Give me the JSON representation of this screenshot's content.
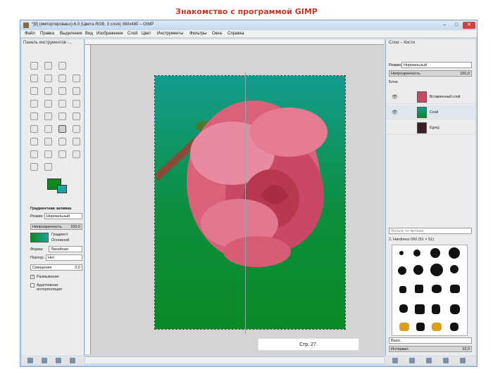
{
  "slide": {
    "title": "Знакомство с программой GIMP",
    "page_label": "Стр. 27."
  },
  "window": {
    "title": "*[8] (импортировано)-6.0 (Цвета RGB, 3 слоя) 360x480 – GIMP",
    "controls": {
      "minimize": "–",
      "maximize": "□",
      "close": "✕"
    }
  },
  "menu": [
    "Файл",
    "Правка",
    "Выделение",
    "Вид",
    "Изображение",
    "Слой",
    "Цвет",
    "Инструменты",
    "Фильтры",
    "Окна",
    "Справка"
  ],
  "toolbox": {
    "title": "Панель инструментов -...",
    "fg_color": "#0b8a1e",
    "bg_color": "#1aa5a0"
  },
  "tool_options": {
    "title": "Градиентная заливка",
    "mode_label": "Режим:",
    "mode_value": "Нормальный",
    "opacity_label": "Непрозрачность",
    "opacity_value": "100,0",
    "gradient_label": "Градиент",
    "gradient_name": "Основной",
    "shape_label": "Форма:",
    "shape_value": "Линейная",
    "repeat_label": "Повтор:",
    "repeat_value": "Нет",
    "offset_label": "Смещение",
    "offset_value": "0,0",
    "dither_label": "Размывание",
    "adaptive_label": "Адаптивная интерполяция"
  },
  "layers_panel": {
    "title": "Слои – Кисти",
    "mode_label": "Режим:",
    "mode_value": "Нормальный",
    "opacity_label": "Непрозрачность",
    "opacity_value": "100,0",
    "lock_label": "Блок:",
    "layers": [
      {
        "name": "Вставленный слой"
      },
      {
        "name": "Слой"
      },
      {
        "name": "8.jpeg"
      }
    ]
  },
  "brushes_panel": {
    "filter_placeholder": "Фильтр по меткам",
    "brush_name": "2. Hardness 050 (51 × 51)",
    "preset_label": "Basic.",
    "spacing_label": "Интервал",
    "spacing_value": "10,0"
  },
  "colors": {
    "accent": "#c0392b",
    "window_bg": "#c9dcef",
    "canvas_top": "#139c8e",
    "canvas_bottom": "#098a26"
  }
}
